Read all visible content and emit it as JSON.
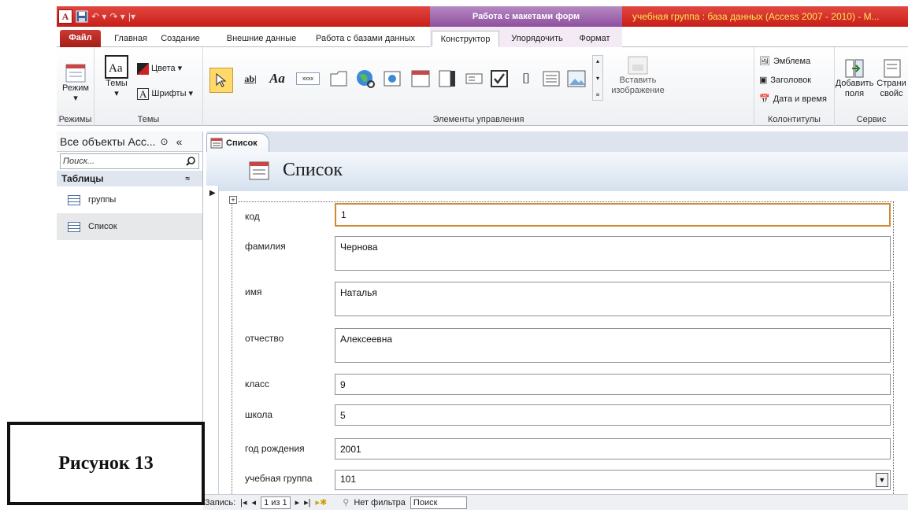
{
  "window": {
    "app_title": "учебная группа : база данных (Access 2007 - 2010)  -  M...",
    "context_header": "Работа с макетами форм"
  },
  "quick_access": {
    "undo": "↶ ▾",
    "redo": "↷ ▾",
    "customize": "|▾"
  },
  "ribbon_tabs": [
    "Файл",
    "Главная",
    "Создание",
    "Внешние данные",
    "Работа с базами данных",
    "Конструктор",
    "Упорядочить",
    "Формат"
  ],
  "ribbon": {
    "views": {
      "label": "Режимы",
      "button": "Режим"
    },
    "themes": {
      "label": "Темы",
      "button": "Темы",
      "colors": "Цвета",
      "fonts": "Шрифты"
    },
    "controls": {
      "label": "Элементы управления",
      "insert_image": "Вставить изображение"
    },
    "header_footer": {
      "label": "Колонтитулы",
      "logo": "Эмблема",
      "title": "Заголовок",
      "datetime": "Дата и время"
    },
    "tools": {
      "label": "Сервис",
      "add_fields": "Добавить поля",
      "property_sheet": "Страни свойс"
    }
  },
  "nav_pane": {
    "title": "Все объекты Acc...",
    "search_placeholder": "Поиск...",
    "section": "Таблицы",
    "items": [
      "группы",
      "Список"
    ]
  },
  "document": {
    "tab": "Список",
    "form_title": "Список"
  },
  "form_fields": [
    {
      "label": "код",
      "value": "1"
    },
    {
      "label": "фамилия",
      "value": "Чернова"
    },
    {
      "label": "имя",
      "value": "Наталья"
    },
    {
      "label": "отчество",
      "value": "Алексеевна"
    },
    {
      "label": "класс",
      "value": "9"
    },
    {
      "label": "школа",
      "value": "5"
    },
    {
      "label": "год рождения",
      "value": "2001"
    },
    {
      "label": "учебная группа",
      "value": "101"
    }
  ],
  "record_nav": {
    "label": "Запись:",
    "position": "1 из 1",
    "filter": "Нет фильтра",
    "search": "Поиск"
  },
  "caption": "Рисунок 13"
}
